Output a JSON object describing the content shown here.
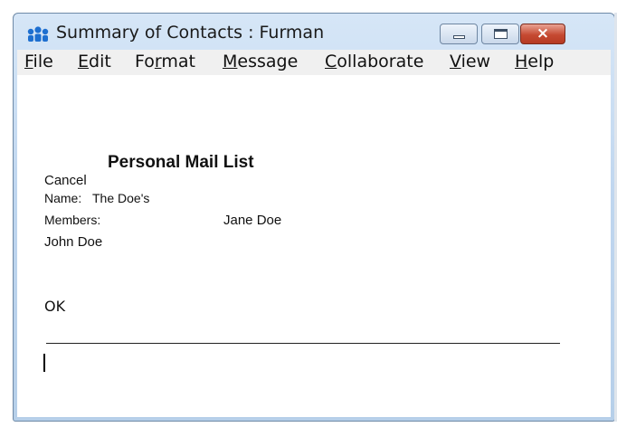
{
  "window": {
    "title": "Summary of Contacts : Furman",
    "controls": {
      "minimize": "minimize",
      "maximize": "maximize",
      "close": "×"
    }
  },
  "menu": [
    {
      "key": "F",
      "rest": "ile"
    },
    {
      "key": "E",
      "rest": "dit"
    },
    {
      "pre": "Fo",
      "key": "r",
      "rest": "mat"
    },
    {
      "key": "M",
      "rest": "essage"
    },
    {
      "key": "C",
      "rest": "ollaborate"
    },
    {
      "key": "V",
      "rest": "iew"
    },
    {
      "key": "H",
      "rest": "elp"
    }
  ],
  "content": {
    "heading": "Personal Mail List",
    "cancel": "Cancel",
    "name_label": "Name:",
    "name_value": "The Doe's",
    "members_label": "Members:",
    "member_1": "Jane Doe",
    "member_2": "John Doe",
    "ok": "OK"
  }
}
